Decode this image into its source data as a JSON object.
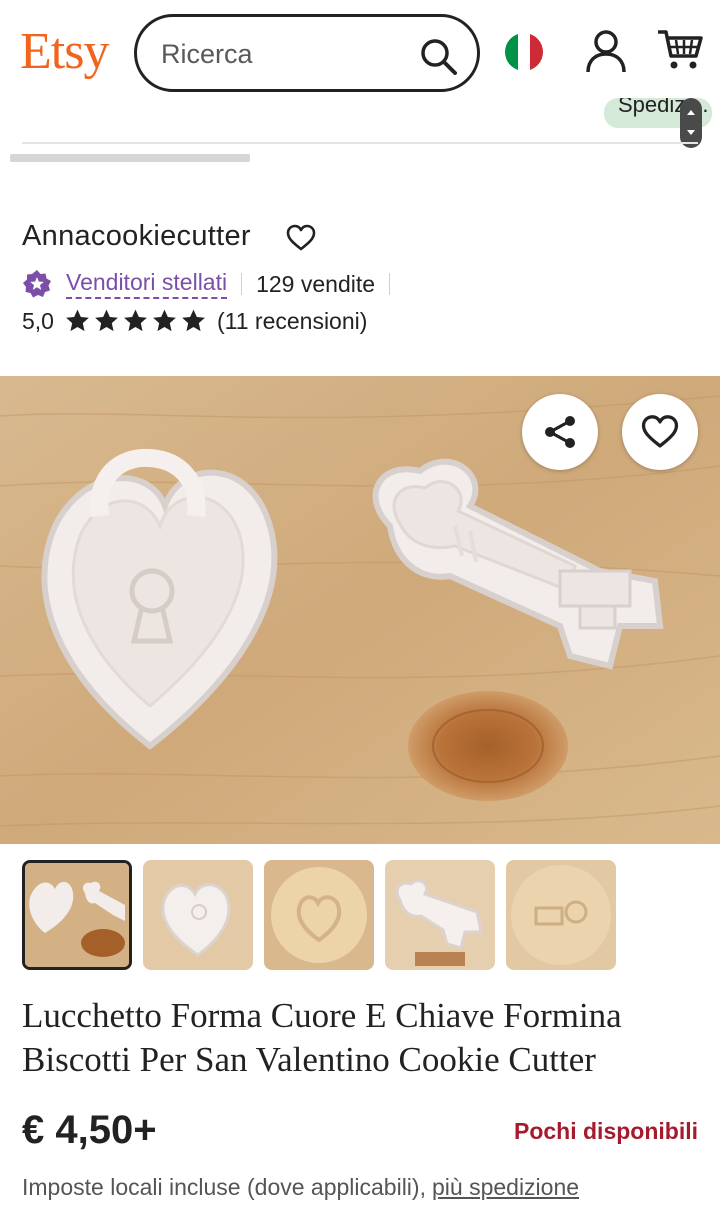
{
  "header": {
    "logo": "Etsy",
    "search_placeholder": "Ricerca"
  },
  "strip": {
    "shipping_chip": "Spedizi..."
  },
  "shop": {
    "name": "Annacookiecutter",
    "star_seller_label": "Venditori stellati",
    "sales": "129 vendite",
    "rating_value": "5,0",
    "stars": 5,
    "reviews": "(11 recensioni)"
  },
  "listing": {
    "title": "Lucchetto Forma Cuore E Chiave Formina Biscotti Per San Valentino Cookie Cutter",
    "price": "€ 4,50+",
    "stock_label": "Pochi disponibili",
    "tax_note": "Imposte locali incluse (dove applicabili),",
    "tax_link": "più spedizione"
  },
  "colors": {
    "brand": "#F1641E",
    "star_seller": "#7B4FA8",
    "stock_warning": "#A61A2E"
  }
}
